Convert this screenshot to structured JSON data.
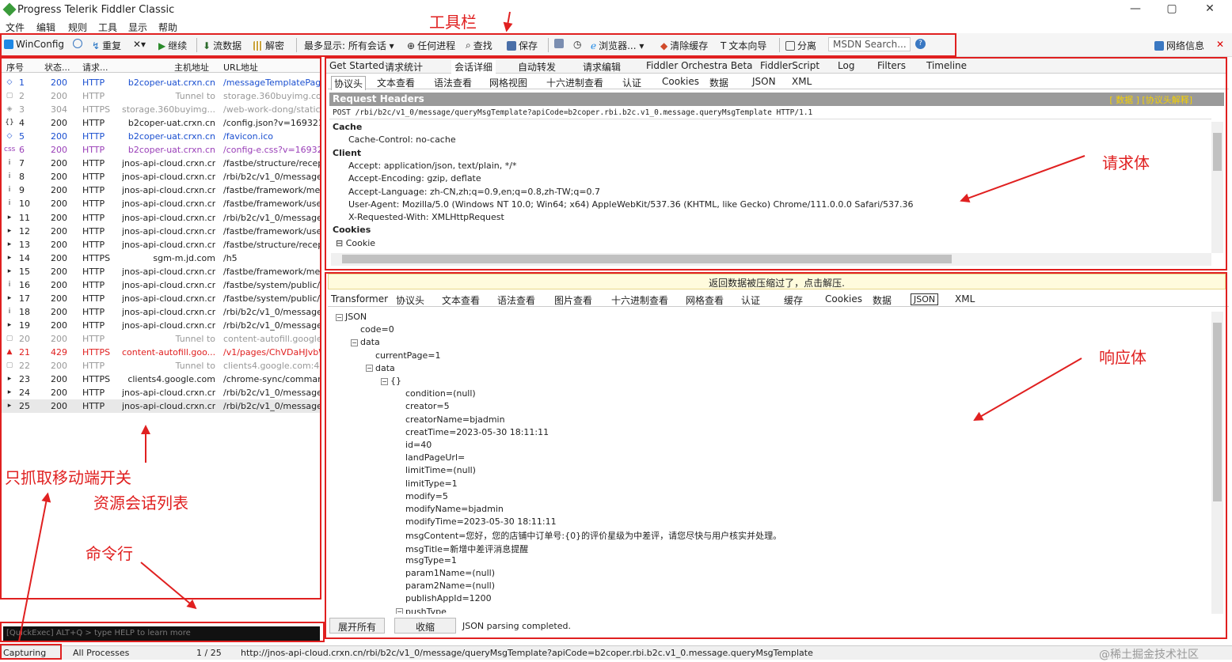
{
  "window": {
    "title": "Progress Telerik Fiddler Classic",
    "min": "—",
    "max": "▢",
    "close": "✕"
  },
  "menu": [
    "文件",
    "编辑",
    "规则",
    "工具",
    "显示",
    "帮助"
  ],
  "toolbar": {
    "winconfig": "WinConfig",
    "replay": "重复",
    "remove": "✕▾",
    "go": "继续",
    "stream": "流数据",
    "decode": "解密",
    "keep": "最多显示: 所有会话 ▾",
    "process": "任何进程",
    "find": "查找",
    "save": "保存",
    "browse": "浏览器... ▾",
    "clear_cache": "清除缓存",
    "text_wizard": "文本向导",
    "tearoff": "分离",
    "msdn": "MSDN Search...",
    "online": "网络信息"
  },
  "annotations": {
    "toolbar": "工具栏",
    "request_body": "请求体",
    "response_body": "响应体",
    "mobile_switch": "只抓取移动端开关",
    "session_list": "资源会话列表",
    "cmdline": "命令行"
  },
  "sessions": {
    "headers": [
      "序号",
      "状态...",
      "请求...",
      "主机地址",
      "URL地址"
    ],
    "rows": [
      {
        "icon": "◇",
        "num": "1",
        "result": "200",
        "proto": "HTTP",
        "host": "b2coper-uat.crxn.cn",
        "url": "/messageTemplatePage",
        "color": "#1a4fd0"
      },
      {
        "icon": "▢",
        "num": "2",
        "result": "200",
        "proto": "HTTP",
        "host": "Tunnel to",
        "url": "storage.360buyimg.com:",
        "color": "#999"
      },
      {
        "icon": "◈",
        "num": "3",
        "result": "304",
        "proto": "HTTPS",
        "host": "storage.360buyimg....",
        "url": "/web-work-dong/static/js",
        "color": "#999"
      },
      {
        "icon": "{}",
        "num": "4",
        "result": "200",
        "proto": "HTTP",
        "host": "b2coper-uat.crxn.cn",
        "url": "/config.json?v=16932129",
        "color": "#222"
      },
      {
        "icon": "◇",
        "num": "5",
        "result": "200",
        "proto": "HTTP",
        "host": "b2coper-uat.crxn.cn",
        "url": "/favicon.ico",
        "color": "#1a4fd0"
      },
      {
        "icon": "css",
        "num": "6",
        "result": "200",
        "proto": "HTTP",
        "host": "b2coper-uat.crxn.cn",
        "url": "/config-e.css?v=1693212",
        "color": "#9a3fb8"
      },
      {
        "icon": "i",
        "num": "7",
        "result": "200",
        "proto": "HTTP",
        "host": "jnos-api-cloud.crxn.cn",
        "url": "/fastbe/structure/recepti",
        "color": "#222"
      },
      {
        "icon": "i",
        "num": "8",
        "result": "200",
        "proto": "HTTP",
        "host": "jnos-api-cloud.crxn.cn",
        "url": "/rbi/b2c/v1_0/message/q",
        "color": "#222"
      },
      {
        "icon": "i",
        "num": "9",
        "result": "200",
        "proto": "HTTP",
        "host": "jnos-api-cloud.crxn.cn",
        "url": "/fastbe/framework/menu",
        "color": "#222"
      },
      {
        "icon": "i",
        "num": "10",
        "result": "200",
        "proto": "HTTP",
        "host": "jnos-api-cloud.crxn.cn",
        "url": "/fastbe/framework/user/",
        "color": "#222"
      },
      {
        "icon": "▸",
        "num": "11",
        "result": "200",
        "proto": "HTTP",
        "host": "jnos-api-cloud.crxn.cn",
        "url": "/rbi/b2c/v1_0/message/q",
        "color": "#222"
      },
      {
        "icon": "▸",
        "num": "12",
        "result": "200",
        "proto": "HTTP",
        "host": "jnos-api-cloud.crxn.cn",
        "url": "/fastbe/framework/user/",
        "color": "#222"
      },
      {
        "icon": "▸",
        "num": "13",
        "result": "200",
        "proto": "HTTP",
        "host": "jnos-api-cloud.crxn.cn",
        "url": "/fastbe/structure/recepti",
        "color": "#222"
      },
      {
        "icon": "▸",
        "num": "14",
        "result": "200",
        "proto": "HTTPS",
        "host": "sgm-m.jd.com",
        "url": "/h5",
        "color": "#222"
      },
      {
        "icon": "▸",
        "num": "15",
        "result": "200",
        "proto": "HTTP",
        "host": "jnos-api-cloud.crxn.cn",
        "url": "/fastbe/framework/menu",
        "color": "#222"
      },
      {
        "icon": "i",
        "num": "16",
        "result": "200",
        "proto": "HTTP",
        "host": "jnos-api-cloud.crxn.cn",
        "url": "/fastbe/system/public/dic",
        "color": "#222"
      },
      {
        "icon": "▸",
        "num": "17",
        "result": "200",
        "proto": "HTTP",
        "host": "jnos-api-cloud.crxn.cn",
        "url": "/fastbe/system/public/dic",
        "color": "#222"
      },
      {
        "icon": "i",
        "num": "18",
        "result": "200",
        "proto": "HTTP",
        "host": "jnos-api-cloud.crxn.cn",
        "url": "/rbi/b2c/v1_0/message/q",
        "color": "#222"
      },
      {
        "icon": "▸",
        "num": "19",
        "result": "200",
        "proto": "HTTP",
        "host": "jnos-api-cloud.crxn.cn",
        "url": "/rbi/b2c/v1_0/message/q",
        "color": "#222"
      },
      {
        "icon": "▢",
        "num": "20",
        "result": "200",
        "proto": "HTTP",
        "host": "Tunnel to",
        "url": "content-autofill.googleap",
        "color": "#999"
      },
      {
        "icon": "▲",
        "num": "21",
        "result": "429",
        "proto": "HTTPS",
        "host": "content-autofill.goo...",
        "url": "/v1/pages/ChVDaHJvbW",
        "color": "#e02020"
      },
      {
        "icon": "▢",
        "num": "22",
        "result": "200",
        "proto": "HTTP",
        "host": "Tunnel to",
        "url": "clients4.google.com:443",
        "color": "#999"
      },
      {
        "icon": "▸",
        "num": "23",
        "result": "200",
        "proto": "HTTPS",
        "host": "clients4.google.com",
        "url": "/chrome-sync/command/?",
        "color": "#222"
      },
      {
        "icon": "▸",
        "num": "24",
        "result": "200",
        "proto": "HTTP",
        "host": "jnos-api-cloud.crxn.cn",
        "url": "/rbi/b2c/v1_0/message/q",
        "color": "#222"
      },
      {
        "icon": "▸",
        "num": "25",
        "result": "200",
        "proto": "HTTP",
        "host": "jnos-api-cloud.crxn.cn",
        "url": "/rbi/b2c/v1_0/message/q",
        "color": "#222"
      }
    ]
  },
  "main_tabs": [
    "Get Started",
    "请求统计",
    "会话详细",
    "自动转发",
    "请求编辑",
    "Fiddler Orchestra Beta",
    "FiddlerScript",
    "Log",
    "Filters",
    "Timeline"
  ],
  "req_tabs": [
    "协议头",
    "文本查看",
    "语法查看",
    "网格视图",
    "十六进制查看",
    "认证",
    "Cookies",
    "数据",
    "JSON",
    "XML"
  ],
  "request": {
    "bar_title": "Request Headers",
    "bar_links": "[ 数据 ]  [协议头解释]",
    "line": "POST /rbi/b2c/v1_0/message/queryMsgTemplate?apiCode=b2coper.rbi.b2c.v1_0.message.queryMsgTemplate HTTP/1.1",
    "lines": [
      {
        "t": "Cache",
        "g": true
      },
      {
        "t": "Cache-Control: no-cache",
        "g": false
      },
      {
        "t": "Client",
        "g": true
      },
      {
        "t": "Accept: application/json, text/plain, */*",
        "g": false
      },
      {
        "t": "Accept-Encoding: gzip, deflate",
        "g": false
      },
      {
        "t": "Accept-Language: zh-CN,zh;q=0.9,en;q=0.8,zh-TW;q=0.7",
        "g": false
      },
      {
        "t": "User-Agent: Mozilla/5.0 (Windows NT 10.0; Win64; x64) AppleWebKit/537.36 (KHTML, like Gecko) Chrome/111.0.0.0 Safari/537.36",
        "g": false
      },
      {
        "t": "X-Requested-With: XMLHttpRequest",
        "g": false
      },
      {
        "t": "Cookies",
        "g": true
      },
      {
        "t": "⊟ Cookie",
        "g": false
      }
    ]
  },
  "notice": "返回数据被压缩过了，点击解压.",
  "resp_tabs": [
    "Transformer",
    "协议头",
    "文本查看",
    "语法查看",
    "图片查看",
    "十六进制查看",
    "网格查看",
    "认证",
    "缓存",
    "Cookies",
    "数据",
    "JSON",
    "XML"
  ],
  "json_tree": [
    {
      "t": "JSON",
      "d": 0,
      "box": "−"
    },
    {
      "t": "code=0",
      "d": 1,
      "box": ""
    },
    {
      "t": "data",
      "d": 1,
      "box": "−"
    },
    {
      "t": "currentPage=1",
      "d": 2,
      "box": ""
    },
    {
      "t": "data",
      "d": 2,
      "box": "−"
    },
    {
      "t": "{}",
      "d": 3,
      "box": "−"
    },
    {
      "t": "condition=(null)",
      "d": 4,
      "box": ""
    },
    {
      "t": "creator=5",
      "d": 4,
      "box": ""
    },
    {
      "t": "creatorName=bjadmin",
      "d": 4,
      "box": ""
    },
    {
      "t": "creatTime=2023-05-30 18:11:11",
      "d": 4,
      "box": ""
    },
    {
      "t": "id=40",
      "d": 4,
      "box": ""
    },
    {
      "t": "landPageUrl=",
      "d": 4,
      "box": ""
    },
    {
      "t": "limitTime=(null)",
      "d": 4,
      "box": ""
    },
    {
      "t": "limitType=1",
      "d": 4,
      "box": ""
    },
    {
      "t": "modify=5",
      "d": 4,
      "box": ""
    },
    {
      "t": "modifyName=bjadmin",
      "d": 4,
      "box": ""
    },
    {
      "t": "modifyTime=2023-05-30 18:11:11",
      "d": 4,
      "box": ""
    },
    {
      "t": "msgContent=您好，您的店铺中订单号:{0}的评价星级为中差评，请您尽快与用户核实并处理。",
      "d": 4,
      "box": ""
    },
    {
      "t": "msgTitle=新增中差评消息提醒",
      "d": 4,
      "box": ""
    },
    {
      "t": "msgType=1",
      "d": 4,
      "box": ""
    },
    {
      "t": "param1Name=(null)",
      "d": 4,
      "box": ""
    },
    {
      "t": "param2Name=(null)",
      "d": 4,
      "box": ""
    },
    {
      "t": "publishAppId=1200",
      "d": 4,
      "box": ""
    },
    {
      "t": "pushType",
      "d": 4,
      "box": "−"
    }
  ],
  "bottom": {
    "expand": "展开所有",
    "collapse": "收缩",
    "status": "JSON parsing completed."
  },
  "cmd_placeholder": "[QuickExec] ALT+Q > type HELP to learn more",
  "statusbar": {
    "capturing": "Capturing",
    "processes": "All Processes",
    "count": "1 / 25",
    "url": "http://jnos-api-cloud.crxn.cn/rbi/b2c/v1_0/message/queryMsgTemplate?apiCode=b2coper.rbi.b2c.v1_0.message.queryMsgTemplate",
    "watermark": "@稀土掘金技术社区"
  }
}
